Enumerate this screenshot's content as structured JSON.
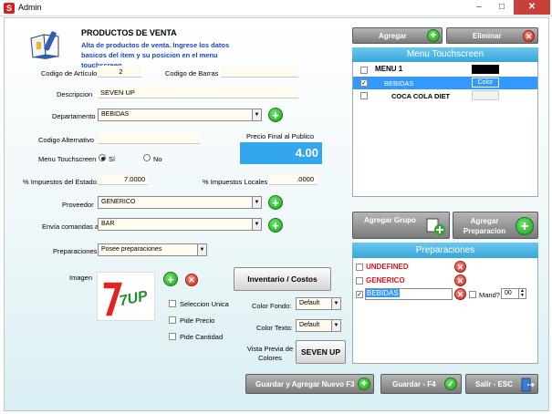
{
  "window": {
    "title": "Admin",
    "icon_letter": "S",
    "minimize": "–",
    "maximize": "□",
    "close": "✕"
  },
  "header": {
    "title": "PRODUCTOS DE VENTA",
    "description": "Alta de productos de venta. Ingrese los datos basicos del ítem y su posicion en el menu touchscreen"
  },
  "form": {
    "codigo_articulo": {
      "label": "Codigo de Artículo",
      "value": "2"
    },
    "codigo_barras": {
      "label": "Codigo de Barras",
      "value": ""
    },
    "descripcion": {
      "label": "Descripcion",
      "value": "SEVEN UP"
    },
    "departamento": {
      "label": "Departamento",
      "value": "BEBIDAS"
    },
    "codigo_alternativo": {
      "label": "Codigo Alternativo",
      "value": ""
    },
    "precio_final": {
      "label": "Precio Final al Publico",
      "value": "4.00"
    },
    "menu_touchscreen": {
      "label": "Menu Touchscreen",
      "si": "Sí",
      "no": "No",
      "selected": "si"
    },
    "impuestos_estado": {
      "label": "% Impuestos del Estado",
      "value": "7.0000"
    },
    "impuestos_locales": {
      "label": "% Impuestos Locales",
      "value": ".0000"
    },
    "proveedor": {
      "label": "Proveedor",
      "value": "GENERICO"
    },
    "envia_comandas": {
      "label": "Envía comandas a",
      "value": "BAR"
    },
    "preparaciones": {
      "label": "Preparaciones",
      "value": "Posee preparaciones"
    },
    "imagen": {
      "label": "Imagen",
      "logo_text": "7UP"
    },
    "seleccion_unica": {
      "label": "Seleccion Unica",
      "checked": false
    },
    "pide_precio": {
      "label": "Pide Precio",
      "checked": false
    },
    "pide_cantidad": {
      "label": "Pide Cantidad",
      "checked": false
    },
    "color_fondo": {
      "label": "Color Fondo:",
      "value": "Default"
    },
    "color_texto": {
      "label": "Color Texto:",
      "value": "Default"
    },
    "vista_previa": {
      "label": "Vista Previa de Colores",
      "value": "SEVEN UP"
    },
    "inventario_costos": "Inventario / Costos"
  },
  "right_top": {
    "agregar": "Agregar",
    "eliminar": "Eliminar"
  },
  "menu_touchscreen_panel": {
    "title": "Menu Touchscreen",
    "rows": [
      {
        "label": "MENU 1",
        "checked": false,
        "color_box": "#000000"
      },
      {
        "label": "BEBIDAS",
        "checked": true,
        "color_label": "Color",
        "selected": true
      },
      {
        "label": "COCA COLA DIET",
        "checked": false,
        "color_box": "#f2f2f2"
      }
    ]
  },
  "grupo_buttons": {
    "agregar_grupo": "Agregar Grupo",
    "agregar_preparacion": "Agregar Preparacion"
  },
  "preparaciones_panel": {
    "title": "Preparaciones",
    "rows": [
      {
        "label": "UNDEFINED",
        "checked": false
      },
      {
        "label": "GENERICO",
        "checked": false
      },
      {
        "label": "BEBIDAS",
        "checked": true,
        "mand_label": "Mand?",
        "mand_value": "00"
      }
    ]
  },
  "footer": {
    "guardar_nuevo": "Guardar y Agregar Nuevo F3",
    "guardar": "Guardar - F4",
    "salir": "Salir - ESC"
  },
  "colors": {
    "accent_blue": "#37a6da",
    "selected_row": "#3399ff",
    "price_bg": "#33a6ee",
    "red_text": "#e8121a"
  }
}
